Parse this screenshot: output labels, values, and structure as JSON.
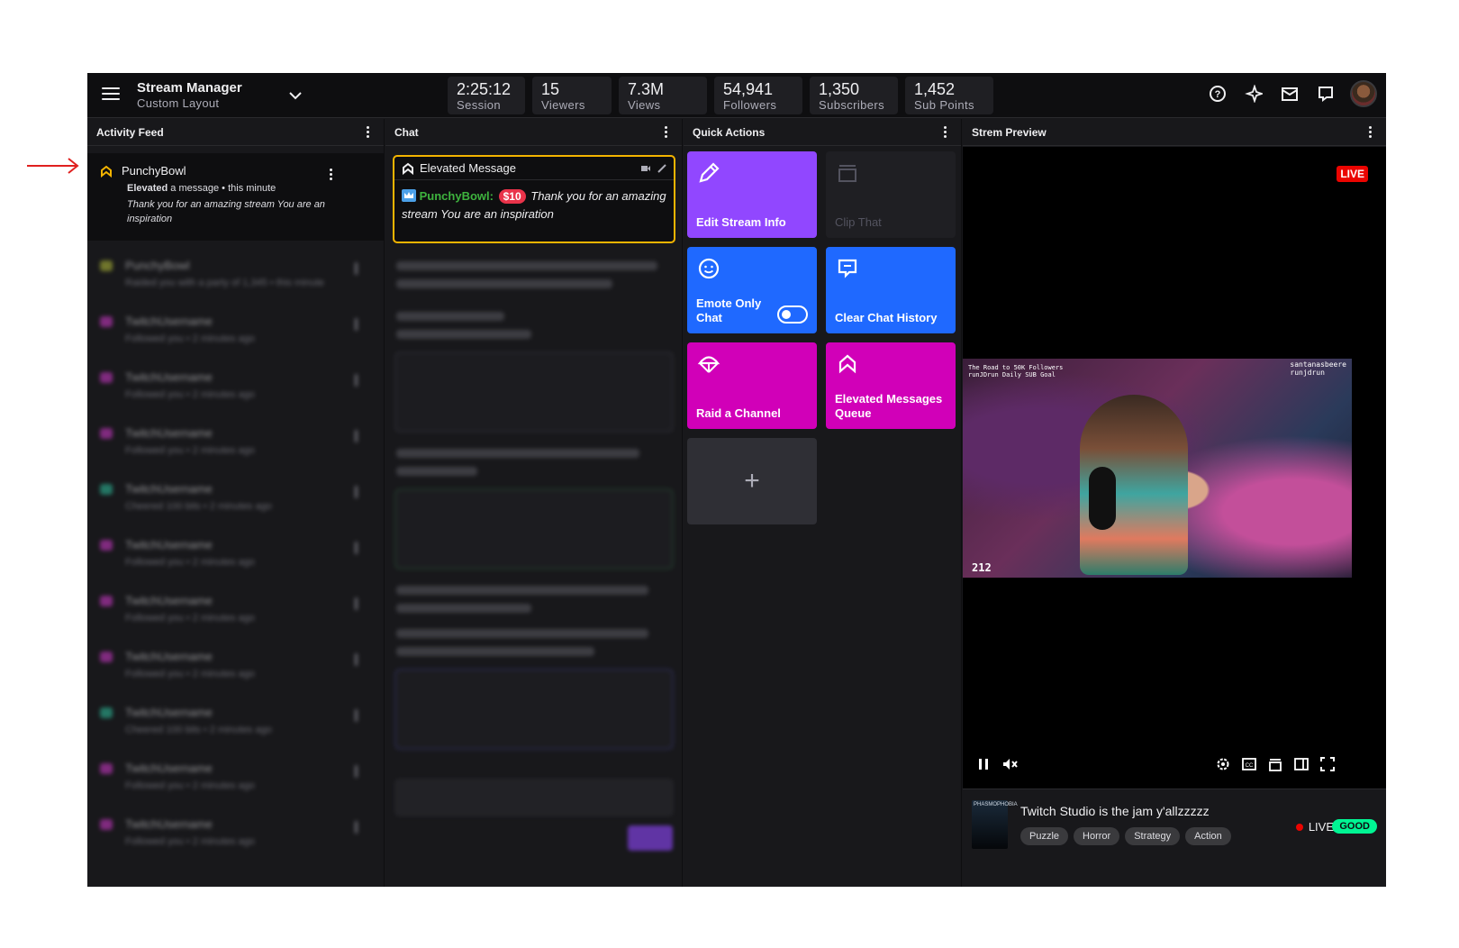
{
  "topbar": {
    "title": "Stream Manager",
    "subtitle": "Custom  Layout",
    "stats": [
      {
        "value": "2:25:12",
        "label": "Session"
      },
      {
        "value": "15",
        "label": "Viewers"
      },
      {
        "value": "7.3M",
        "label": "Views"
      },
      {
        "value": "54,941",
        "label": "Followers"
      },
      {
        "value": "1,350",
        "label": "Subscribers"
      },
      {
        "value": "1,452",
        "label": "Sub Points"
      }
    ],
    "icons": [
      "help-icon",
      "sparkle-icon",
      "inbox-icon",
      "whispers-icon",
      "avatar"
    ]
  },
  "activity": {
    "title": "Activity Feed",
    "focused": {
      "user": "PunchyBowl",
      "action": "Elevated",
      "action_rest": " a message • this minute",
      "message": "Thank you for an amazing stream You are an inspiration"
    },
    "items": [
      {
        "name": "PunchyBowl",
        "sub": "Raided you with a party of 1,345 • this minute",
        "color": "#b8c23a"
      },
      {
        "name": "TwitchUsername",
        "sub": "Followed you • 2 minutes ago",
        "color": "#d53ad0"
      },
      {
        "name": "TwitchUsername",
        "sub": "Followed you • 2 minutes ago",
        "color": "#d53ad0"
      },
      {
        "name": "TwitchUsername",
        "sub": "Followed you • 2 minutes ago",
        "color": "#d53ad0"
      },
      {
        "name": "TwitchUsername",
        "sub": "Cheered 100 bits • 2 minutes ago",
        "color": "#2ec4a0"
      },
      {
        "name": "TwitchUsername",
        "sub": "Followed you • 2 minutes ago",
        "color": "#d53ad0"
      },
      {
        "name": "TwitchUsername",
        "sub": "Followed you • 2 minutes ago",
        "color": "#d53ad0"
      },
      {
        "name": "TwitchUsername",
        "sub": "Followed you • 2 minutes ago",
        "color": "#d53ad0"
      },
      {
        "name": "TwitchUsername",
        "sub": "Cheered 100 bits • 2 minutes ago",
        "color": "#2ec4a0"
      },
      {
        "name": "TwitchUsername",
        "sub": "Followed you • 2 minutes ago",
        "color": "#d53ad0"
      },
      {
        "name": "TwitchUsername",
        "sub": "Followed you • 2 minutes ago",
        "color": "#d53ad0"
      }
    ]
  },
  "chat": {
    "title": "Chat",
    "elevated": {
      "header": "Elevated Message",
      "user": "PunchyBowl:",
      "amount": "$10",
      "message": "Thank you for an amazing stream You are an inspiration"
    }
  },
  "quick": {
    "title": "Quick Actions",
    "tiles": [
      {
        "label": "Edit Stream Info",
        "color": "#9147ff"
      },
      {
        "label": "Clip That",
        "color": "#1f1f23"
      },
      {
        "label": "Emote Only Chat",
        "color": "#1f69ff"
      },
      {
        "label": "Clear Chat History",
        "color": "#1f69ff"
      },
      {
        "label": "Raid a Channel",
        "color": "#d100b8"
      },
      {
        "label": "Elevated Messages Queue",
        "color": "#d100b8"
      }
    ],
    "add_label": "+"
  },
  "preview": {
    "title": "Strem Preview",
    "live_badge": "LIVE",
    "overlay_left": "The Road to 50K Followers",
    "overlay_left2": "runJDrun Daily SUB Goal",
    "overlay_right": "santanasbeere",
    "overlay_right2": "runjdrun",
    "viewer_overlay": "212",
    "thumb_text": "PHASMOPHOBIA",
    "stream_title": "Twitch Studio is the jam y'allzzzzz",
    "tags": [
      "Puzzle",
      "Horror",
      "Strategy",
      "Action"
    ],
    "live_status": "LIVE",
    "health": "GOOD"
  }
}
